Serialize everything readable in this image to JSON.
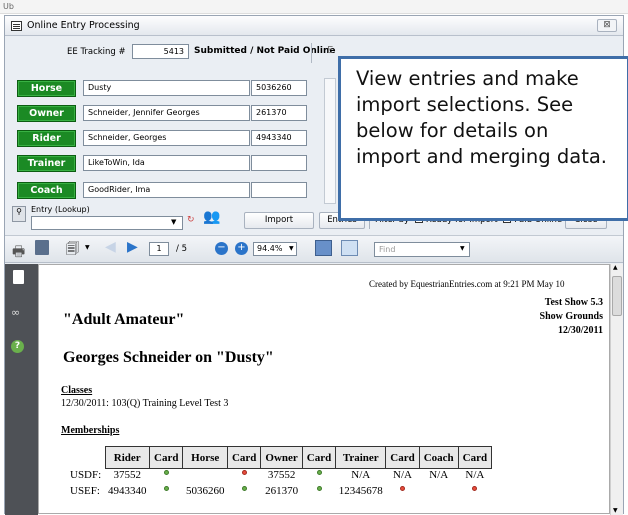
{
  "corner_text": "Ub",
  "window": {
    "title": "Online Entry Processing",
    "close_glyph": "⊠"
  },
  "tracking": {
    "label": "EE Tracking #",
    "value": "5413",
    "status": "Submitted / Not Paid Online",
    "right_fragment": "E"
  },
  "fields": [
    {
      "label": "Horse",
      "name": "Dusty",
      "number": "5036260"
    },
    {
      "label": "Owner",
      "name": "Schneider, Jennifer Georges",
      "number": "261370"
    },
    {
      "label": "Rider",
      "name": "Schneider, Georges",
      "number": "4943340"
    },
    {
      "label": "Trainer",
      "name": "LikeToWin, Ida",
      "number": ""
    },
    {
      "label": "Coach",
      "name": "GoodRider, Ima",
      "number": ""
    }
  ],
  "lookup": {
    "label": "Entry (Lookup)",
    "value": ""
  },
  "actions": {
    "import": "Import",
    "entries": "Entries",
    "filter_label": "Filter by",
    "ready_for_import": "Ready for Import",
    "paid_online": "Paid Online",
    "close": "Close"
  },
  "viewer": {
    "page": "1",
    "total": "/ 5",
    "zoom": "94.4%",
    "find_placeholder": "Find"
  },
  "callout": "View entries and make import selections. See below for details on import and merging data.",
  "report": {
    "created": "Created by EquestrianEntries.com at 9:21 PM May 10",
    "show_name": "Test Show 5.3",
    "grounds": "Show Grounds",
    "date": "12/30/2011",
    "division": "\"Adult Amateur\"",
    "entry_title": "Georges Schneider on \"Dusty\"",
    "classes_heading": "Classes",
    "class_line": "12/30/2011: 103(Q) Training Level Test 3",
    "memberships_heading": "Memberships",
    "table": {
      "headers": [
        "",
        "Rider",
        "Card",
        "Horse",
        "Card",
        "Owner",
        "Card",
        "Trainer",
        "Card",
        "Coach",
        "Card"
      ],
      "rows": [
        {
          "org": "USDF:",
          "rider": "37552",
          "rider_card": "green",
          "horse": "",
          "horse_card": "red",
          "owner": "37552",
          "owner_card": "green",
          "trainer": "N/A",
          "trainer_card": "N/A",
          "coach": "N/A",
          "coach_card": "N/A"
        },
        {
          "org": "USEF:",
          "rider": "4943340",
          "rider_card": "green",
          "horse": "5036260",
          "horse_card": "green",
          "owner": "261370",
          "owner_card": "green",
          "trainer": "12345678",
          "trainer_card": "red",
          "coach": "",
          "coach_card": "red"
        }
      ]
    }
  },
  "colors": {
    "field_button_green": "#1b8a24",
    "callout_border": "#3f6ea8",
    "sidebar": "#4e5156"
  }
}
